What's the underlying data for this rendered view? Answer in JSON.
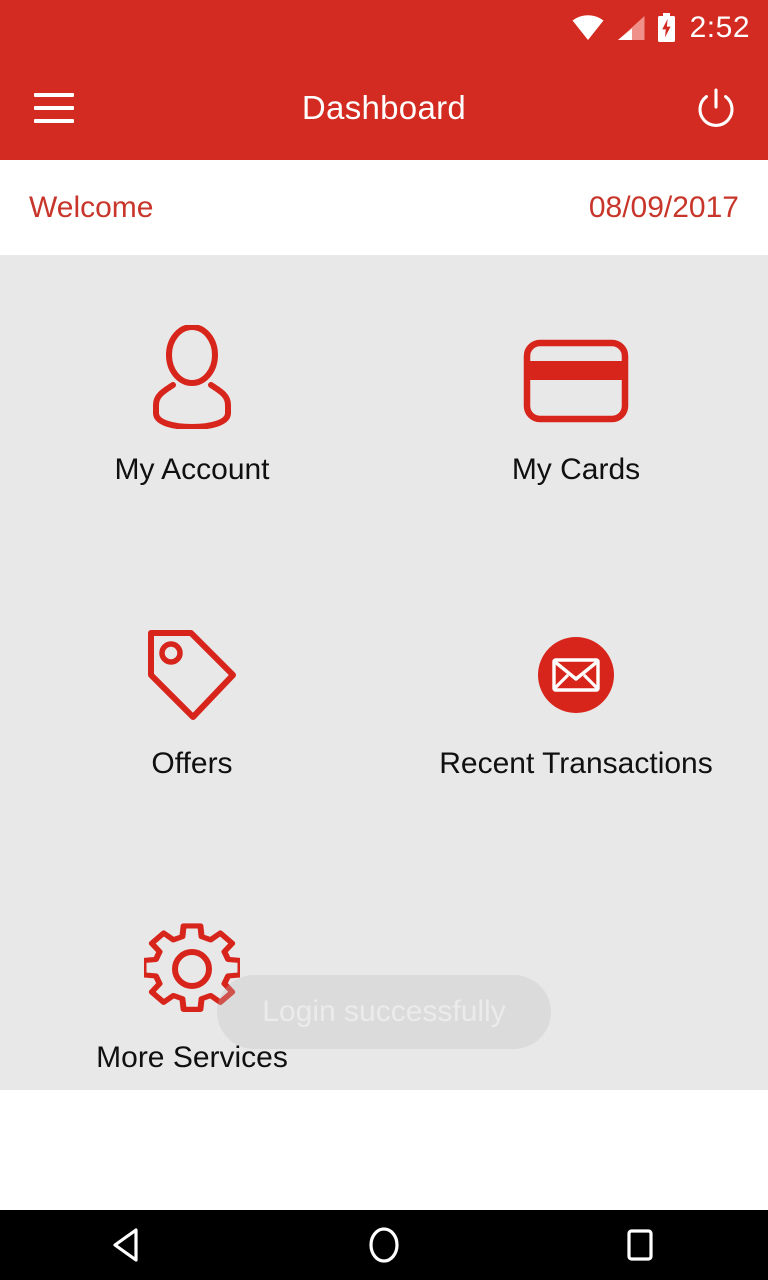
{
  "status_bar": {
    "time": "2:52",
    "icons": [
      "wifi-icon",
      "cellular-signal-icon",
      "battery-charging-icon"
    ]
  },
  "app_bar": {
    "menu_icon": "hamburger-menu-icon",
    "title": "Dashboard",
    "power_icon": "power-icon"
  },
  "welcome_bar": {
    "greeting": "Welcome",
    "date": "08/09/2017"
  },
  "dashboard": {
    "tiles": [
      {
        "label": "My Account",
        "icon": "user-icon"
      },
      {
        "label": "My Cards",
        "icon": "credit-card-icon"
      },
      {
        "label": "Offers",
        "icon": "price-tag-icon"
      },
      {
        "label": "Recent Transactions",
        "icon": "envelope-icon"
      },
      {
        "label": "More Services",
        "icon": "gear-icon"
      }
    ]
  },
  "toast": {
    "message": "Login successfully"
  },
  "navigation_bar": {
    "back": "back-triangle-icon",
    "home": "home-circle-icon",
    "recents": "recents-square-icon"
  },
  "colors": {
    "brand_red": "#D32A21",
    "icon_red": "#D8251C",
    "welcome_red": "#C8352A",
    "content_bg": "#E8E8E9",
    "label_text": "#101010",
    "navbar_bg": "#000000"
  }
}
